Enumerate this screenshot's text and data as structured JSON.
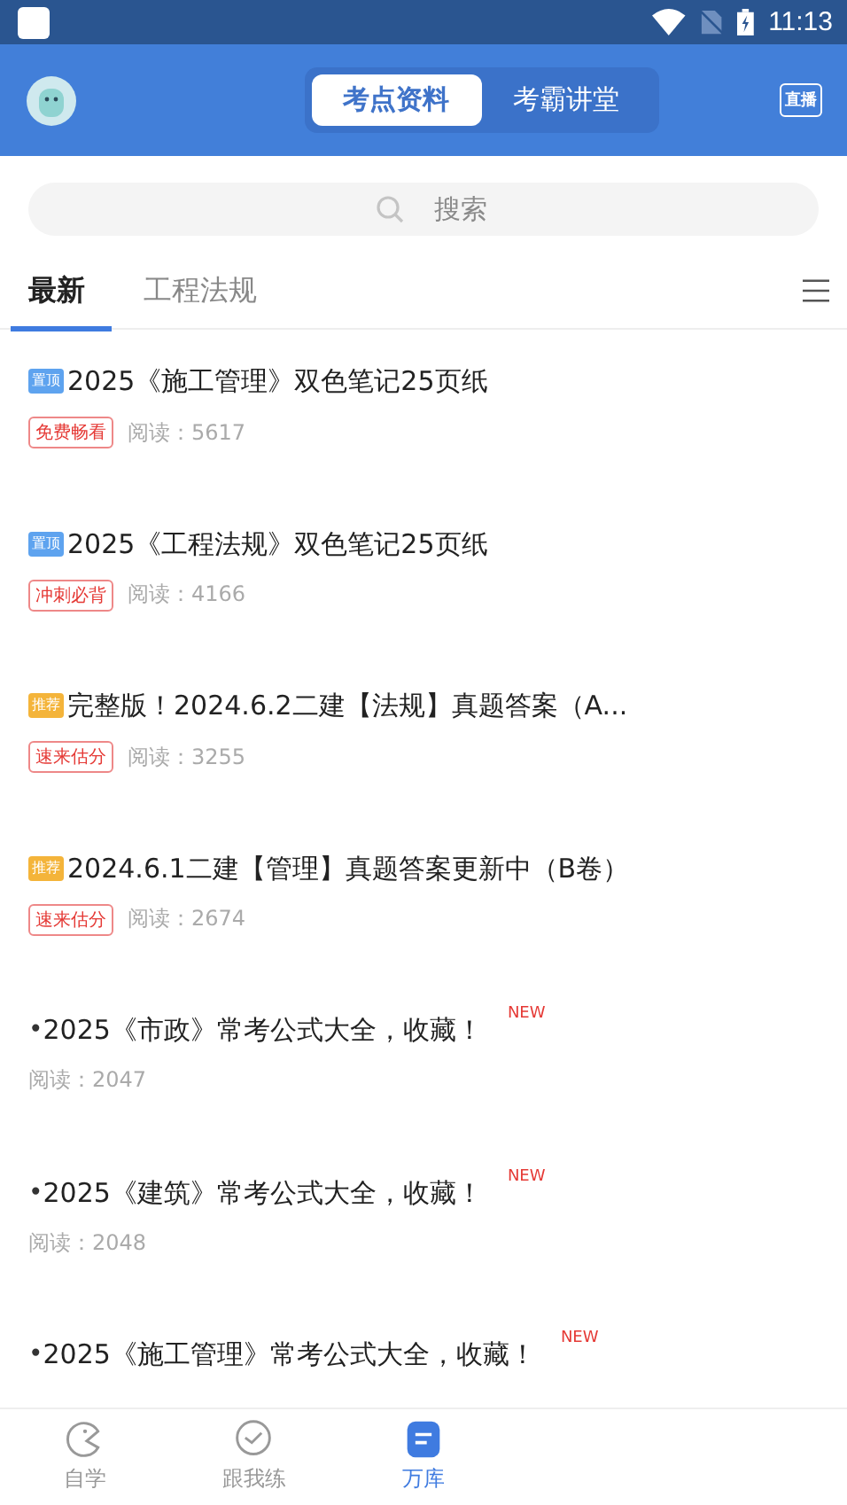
{
  "status_bar": {
    "time": "11:13"
  },
  "header": {
    "segments": [
      {
        "label": "考点资料",
        "selected": true
      },
      {
        "label": "考霸讲堂",
        "selected": false
      }
    ],
    "live_label": "直播"
  },
  "search": {
    "placeholder": "搜索"
  },
  "categories": [
    {
      "label": "最新",
      "selected": true
    },
    {
      "label": "工程法规",
      "selected": false
    }
  ],
  "articles": [
    {
      "kind": "badged",
      "badge": {
        "kind": "pin",
        "text": "置顶"
      },
      "title": "2025《施工管理》双色笔记25页纸",
      "tag": "免费畅看",
      "reads": "阅读：5617"
    },
    {
      "kind": "badged",
      "badge": {
        "kind": "pin",
        "text": "置顶"
      },
      "title": "2025《工程法规》双色笔记25页纸",
      "tag": "冲刺必背",
      "reads": "阅读：4166"
    },
    {
      "kind": "badged",
      "badge": {
        "kind": "recommend",
        "text": "推荐"
      },
      "title": "完整版！2024.6.2二建【法规】真题答案（A...",
      "tag": "速来估分",
      "reads": "阅读：3255"
    },
    {
      "kind": "badged",
      "badge": {
        "kind": "recommend",
        "text": "推荐"
      },
      "title": "2024.6.1二建【管理】真题答案更新中（B卷）",
      "tag": "速来估分",
      "reads": "阅读：2674"
    },
    {
      "kind": "bullet",
      "bullet": "•",
      "title": "2025《市政》常考公式大全，收藏！",
      "flag": "NEW",
      "reads": "阅读：2047"
    },
    {
      "kind": "bullet",
      "bullet": "•",
      "title": "2025《建筑》常考公式大全，收藏！",
      "flag": "NEW",
      "reads": "阅读：2048"
    },
    {
      "kind": "bullet",
      "bullet": "•",
      "title": "2025《施工管理》常考公式大全，收藏！",
      "flag": "NEW"
    }
  ],
  "bottom_nav": [
    {
      "kind": "study",
      "label": "自学",
      "selected": false
    },
    {
      "kind": "practice",
      "label": "跟我练",
      "selected": false
    },
    {
      "kind": "library",
      "label": "万库",
      "selected": true
    }
  ]
}
